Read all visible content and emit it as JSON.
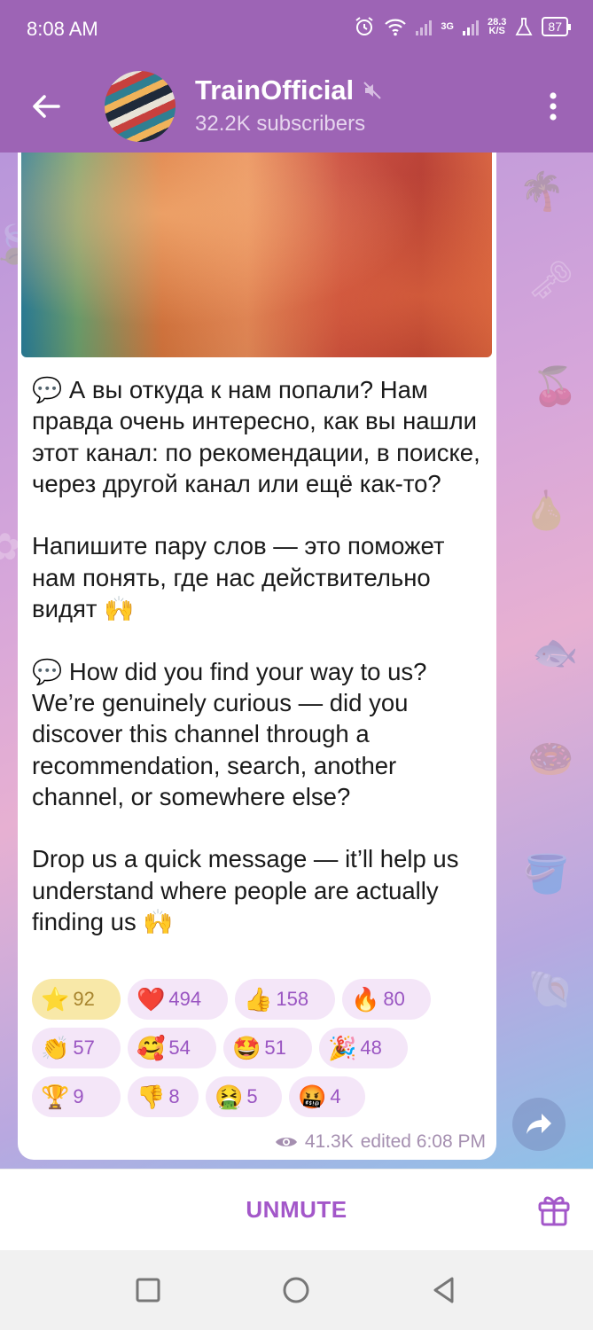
{
  "status": {
    "time": "8:08 AM",
    "network": "3G",
    "speed_value": "28.3",
    "speed_unit": "K/S",
    "battery": "87"
  },
  "header": {
    "title": "TrainOfficial",
    "subtitle": "32.2K subscribers"
  },
  "message": {
    "paragraphs": [
      "💬 А вы откуда к нам попали? Нам правда очень интересно, как вы нашли этот канал: по рекомендации, в поиске, через другой канал или ещё как-то?",
      "Напишите пару слов — это поможет нам понять, где нас действительно видят 🙌",
      "💬 How did you find your way to us? We’re genuinely curious — did you discover this channel through a recommendation, search, another channel, or somewhere else?",
      "Drop us a quick message — it’ll help us understand where people are actually finding us 🙌"
    ],
    "reactions_row1": [
      {
        "emoji": "⭐",
        "count": "92"
      },
      {
        "emoji": "❤️",
        "count": "494"
      },
      {
        "emoji": "👍",
        "count": "158"
      },
      {
        "emoji": "🔥",
        "count": "80"
      }
    ],
    "reactions_row2": [
      {
        "emoji": "👏",
        "count": "57"
      },
      {
        "emoji": "🥰",
        "count": "54"
      },
      {
        "emoji": "🤩",
        "count": "51"
      },
      {
        "emoji": "🎉",
        "count": "48"
      }
    ],
    "reactions_row3": [
      {
        "emoji": "🏆",
        "count": "9"
      },
      {
        "emoji": "👎",
        "count": "8"
      },
      {
        "emoji": "🤮",
        "count": "5"
      },
      {
        "emoji": "🤬",
        "count": "4"
      }
    ],
    "views": "41.3K",
    "edited": "edited 6:08 PM"
  },
  "bottom": {
    "unmute_label": "UNMUTE"
  },
  "colors": {
    "header": "#9d64b5",
    "accent": "#a357c9",
    "reaction_active": "#f8e8a8",
    "reaction_bg": "#f4e6f8"
  }
}
